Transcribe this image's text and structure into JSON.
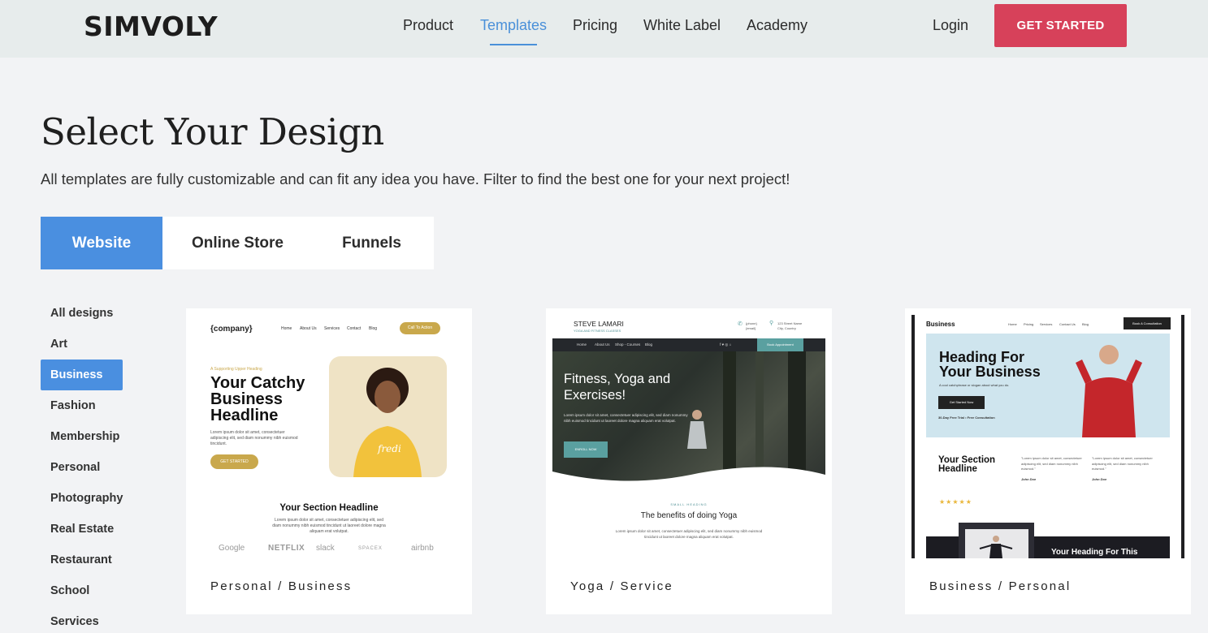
{
  "header": {
    "logo": "SIMVOLY",
    "nav": [
      "Product",
      "Templates",
      "Pricing",
      "White Label",
      "Academy"
    ],
    "active_nav": "Templates",
    "login": "Login",
    "cta": "GET STARTED"
  },
  "title": "Select Your Design",
  "subtitle": "All templates are fully customizable and can fit any idea you have. Filter to find the best one for your next project!",
  "tabs": [
    "Website",
    "Online Store",
    "Funnels"
  ],
  "active_tab": "Website",
  "categories": [
    "All designs",
    "Art",
    "Business",
    "Fashion",
    "Membership",
    "Personal",
    "Photography",
    "Real Estate",
    "Restaurant",
    "School",
    "Services"
  ],
  "active_category": "Business",
  "cards": [
    {
      "label": "Personal / Business",
      "thumb": {
        "logo": "{company}",
        "nav": [
          "Home",
          "About Us",
          "Services",
          "Contact",
          "Blog"
        ],
        "nav_button": "Call To Action",
        "eyebrow": "A Supporting Upper Heading",
        "headline": "Your Catchy Business Headline",
        "body": "Lorem ipsum dolor sit amet, consectetuer adipiscing elit, sed diam nonummy nibh euismod tincidunt.",
        "button": "GET STARTED",
        "shirt_text": "fredi",
        "section_headline": "Your Section Headline",
        "section_body": "Lorem ipsum dolor sit amet, consectetuer adipiscing elit, sed diam nonummy nibh euismod tincidunt ut laoreet dolore magna aliquam erat volutpat.",
        "logos": [
          "Google",
          "NETFLIX",
          "slack",
          "SPACEX",
          "airbnb"
        ]
      }
    },
    {
      "label": "Yoga / Service",
      "thumb": {
        "name": "STEVE LAMARI",
        "tagline": "YOGA AND FITNESS CLASSES",
        "phone": "{phone}",
        "email": "{email}",
        "address_line1": "123 Street Name",
        "address_line2": "City, Country",
        "nav": [
          "Home",
          "About Us",
          "Shop - Courses",
          "Blog"
        ],
        "nav_button": "Book Appointment",
        "hero_title": "Fitness, Yoga and Exercises!",
        "hero_body": "Lorem ipsum dolor sit amet, consectetuer adipiscing elit, sed diam nonummy nibh euismod tincidunt ut laoreet dolore magna aliquam erat volutpat.",
        "hero_button": "ENROLL NOW",
        "small_heading": "SMALL HEADING",
        "section_headline": "The benefits of doing Yoga",
        "section_body": "Lorem ipsum dolor sit amet, consectetuer adipiscing elit, sed diam nonummy nibh euismod tincidunt ut laoreet dolore magna aliquam erat volutpat."
      }
    },
    {
      "label": "Business / Personal",
      "thumb": {
        "brand": "Business",
        "nav": [
          "Home",
          "Pricing",
          "Services",
          "Contact Us",
          "Blog"
        ],
        "nav_button": "Book A Consultation",
        "hero_headline": "Heading For Your Business",
        "hero_sub": "A cool catchphrase or slogan about what you do.",
        "hero_button": "Get Started Now",
        "hero_note": "30-Day Free Trial  •  Free Consultation",
        "section_headline": "Your Section Headline",
        "stars": "★★★★★",
        "testimonial": "\"Lorem ipsum dolor sit amet, consectetuer adipiscing elit, sed diam nonummy nibh euismod.\"",
        "testimonial_author": "John Doe",
        "dark_heading": "Your Heading For This"
      }
    }
  ],
  "colors": {
    "accent_blue": "#4a8fe0",
    "cta_red": "#d7415a",
    "header_bg": "#e7ecec",
    "gold": "#c9a84c",
    "teal": "#5aa0a0"
  }
}
